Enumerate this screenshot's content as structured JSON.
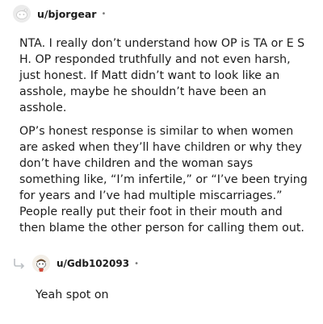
{
  "comment": {
    "username": "u/bjorgear",
    "separator": "•",
    "paragraphs": [
      "NTA. I really don’t understand how OP is TA or E S H. OP responded truthfully and not even harsh, just honest. If Matt didn’t want to look like an asshole, maybe he shouldn’t have been an asshole.",
      "OP’s honest response is similar to when women are asked when they’ll have children or why they don’t have children and the woman says something like, “I’m infertile,” or “I’ve been trying for years and I’ve had multiple miscarriages.” People really put their foot in their mouth and then blame the other person for calling them out."
    ]
  },
  "reply": {
    "username": "u/Gdb102093",
    "separator": "•",
    "text": "Yeah spot on"
  },
  "icons": {
    "comment_avatar": "default-avatar-icon",
    "reply_arrow": "reply-arrow-icon",
    "reply_avatar": "snoo-avatar-icon"
  },
  "colors": {
    "text": "#1c1c1c",
    "muted": "#7c7c7c",
    "arrow": "#bcc0c4"
  }
}
